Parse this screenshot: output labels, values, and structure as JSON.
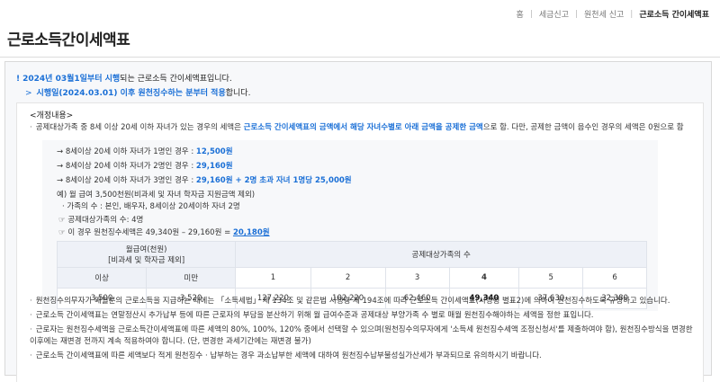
{
  "breadcrumb": [
    "홈",
    "세금신고",
    "원천세 신고",
    "근로소득 간이세액표"
  ],
  "page_title": "근로소득간이세액표",
  "notice": {
    "line1_mark": "!",
    "line1_highlight": "2024년 03월1일부터 시행",
    "line1_rest": "되는 근로소득 간이세액표입니다.",
    "line2_arrow": ">",
    "line2_highlight": "시행일(2024.03.01) 이후 원천징수하는 분부터 적용",
    "line2_rest": "합니다."
  },
  "section_title": "<개정내용>",
  "rule": {
    "bullet": "·",
    "pre": "공제대상가족 중 8세 이상 20세 이하 자녀가 있는 경우의 세액은 ",
    "highlight": "근로소득 간이세액표의 금액에서 해당 자녀수별로 아래 금액을 공제한 금액",
    "post": "으로 함. 다만, 공제한 금액이 음수인 경우의 세액은 0원으로 함"
  },
  "examples": {
    "items": [
      {
        "label": "→ 8세이상 20세 이하 자녀가 1명인 경우 : ",
        "value": "12,500원"
      },
      {
        "label": "→ 8세이상 20세 이하 자녀가 2명인 경우 : ",
        "value": "29,160원"
      },
      {
        "label": "→ 8세이상 20세 이하 자녀가 3명인 경우 : ",
        "value": "29,160원 + 2명 초과 자녀 1명당 25,000원"
      }
    ],
    "example_heading": "예) 월 급여 3,500천원(비과세 및 자녀 학자금 지원금액 제외)",
    "family": "· 가족의 수 : 본인, 배우자, 8세이상 20세이하 자녀 2명",
    "deduct_family": "☞ 공제대상가족의 수: 4명",
    "calc_pre": "☞ 이 경우 원천징수세액은 49,340원 – 29,160원 = ",
    "calc_result": "20,180원"
  },
  "table": {
    "header_salary": "월급여(천원)",
    "header_salary_sub": "[비과세 및 학자금 제외]",
    "header_family": "공제대상가족의 수",
    "sub_min": "이상",
    "sub_max": "미만",
    "family_cols": [
      "1",
      "2",
      "3",
      "4",
      "5",
      "6"
    ],
    "row": {
      "min": "3,500",
      "max": "3,520",
      "values": [
        "127,220",
        "102,220",
        "62,460",
        "49,340",
        "37,630",
        "32,380"
      ]
    }
  },
  "notes": [
    "원천징수의무자가 매월분의 근로소득을 지급하는 때에는 「소득세법」 제 134조 및 같은법 시행령 제 194조에 따라 근로소득 간이세액표(시행령 별표2)에 의하여 원천징수하도록 규정하고 있습니다.",
    "근로소득 간이세액표는 연말정산시 추가납부 등에 따른 근로자의 부담을 분산하기 위해 월 급여수준과 공제대상 부양가족 수 별로 매월 원천징수해야하는 세액을 정한 표입니다.",
    "근로자는 원천징수세액을 근로소득간이세액표에 따른 세액의 80%, 100%, 120% 중에서 선택할 수 있으며(원천징수의무자에게 '소득세 원천징수세액 조정신청서'를 제출하여야 함), 원천징수방식을 변경한 이후에는 재변경 전까지 계속 적용하여야 합니다. (단, 변경한 과세기간에는 재변경 불가)",
    "근로소득 간이세액표에 따른 세액보다 적게 원천징수 · 납부하는 경우 과소납부한 세액에 대하여 원천징수납부불성실가산세가 부과되므로 유의하시기 바랍니다."
  ],
  "colors": {
    "accent": "#1a6fd6",
    "header_bg": "#eef1f7",
    "panel_bg": "#f7f8fa"
  }
}
